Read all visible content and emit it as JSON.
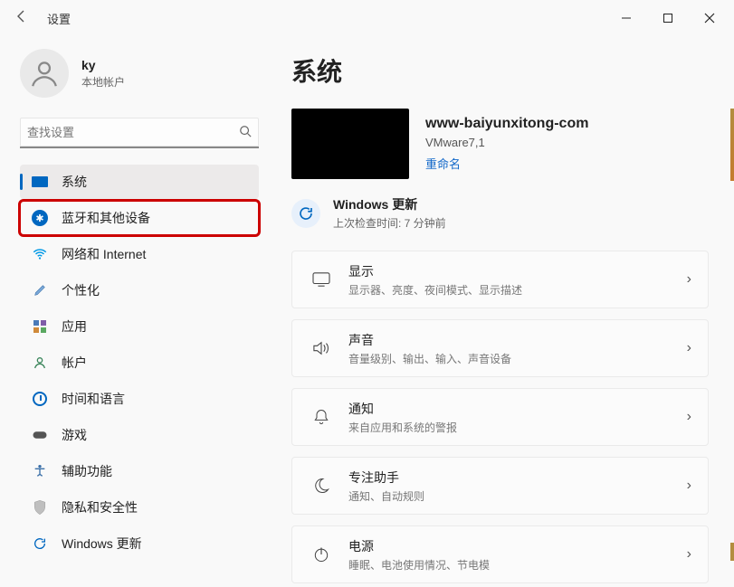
{
  "titlebar": {
    "title": "设置"
  },
  "user": {
    "name": "ky",
    "account_type": "本地帐户"
  },
  "search": {
    "placeholder": "查找设置"
  },
  "nav": {
    "items": [
      {
        "label": "系统"
      },
      {
        "label": "蓝牙和其他设备"
      },
      {
        "label": "网络和 Internet"
      },
      {
        "label": "个性化"
      },
      {
        "label": "应用"
      },
      {
        "label": "帐户"
      },
      {
        "label": "时间和语言"
      },
      {
        "label": "游戏"
      },
      {
        "label": "辅助功能"
      },
      {
        "label": "隐私和安全性"
      },
      {
        "label": "Windows 更新"
      }
    ]
  },
  "page": {
    "title": "系统"
  },
  "device": {
    "name": "www-baiyunxitong-com",
    "model": "VMware7,1",
    "rename": "重命名"
  },
  "update": {
    "title": "Windows 更新",
    "sub_prefix": "上次检查时间: ",
    "sub_value": "7 分钟前"
  },
  "cards": [
    {
      "title": "显示",
      "sub": "显示器、亮度、夜间模式、显示描述"
    },
    {
      "title": "声音",
      "sub": "音量级别、输出、输入、声音设备"
    },
    {
      "title": "通知",
      "sub": "来自应用和系统的警报"
    },
    {
      "title": "专注助手",
      "sub": "通知、自动规则"
    },
    {
      "title": "电源",
      "sub": "睡眠、电池使用情况、节电模"
    }
  ]
}
